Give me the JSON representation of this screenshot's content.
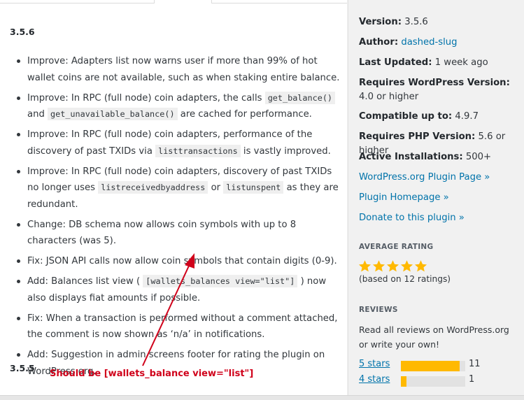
{
  "main": {
    "versions": [
      "3.5.6",
      "3.5.5"
    ],
    "changes": [
      {
        "parts": [
          {
            "t": "text",
            "v": "Improve: Adapters list now warns user if more than 99% of hot wallet coins are not available, such as when staking entire balance."
          }
        ]
      },
      {
        "parts": [
          {
            "t": "text",
            "v": "Improve: In RPC (full node) coin adapters, the calls "
          },
          {
            "t": "code",
            "v": "get_balance()"
          },
          {
            "t": "text",
            "v": " and "
          },
          {
            "t": "code",
            "v": "get_unavailable_balance()"
          },
          {
            "t": "text",
            "v": " are cached for performance."
          }
        ]
      },
      {
        "parts": [
          {
            "t": "text",
            "v": "Improve: In RPC (full node) coin adapters, performance of the discovery of past TXIDs via "
          },
          {
            "t": "code",
            "v": "listtransactions"
          },
          {
            "t": "text",
            "v": " is vastly improved."
          }
        ]
      },
      {
        "parts": [
          {
            "t": "text",
            "v": "Improve: In RPC (full node) coin adapters, discovery of past TXIDs no longer uses "
          },
          {
            "t": "code",
            "v": "listreceivedbyaddress"
          },
          {
            "t": "text",
            "v": " or "
          },
          {
            "t": "code",
            "v": "listunspent"
          },
          {
            "t": "text",
            "v": " as they are redundant."
          }
        ]
      },
      {
        "parts": [
          {
            "t": "text",
            "v": "Change: DB schema now allows coin symbols with up to 8 characters (was 5)."
          }
        ]
      },
      {
        "parts": [
          {
            "t": "text",
            "v": "Fix: JSON API calls now allow coin symbols that contain digits (0-9)."
          }
        ]
      },
      {
        "parts": [
          {
            "t": "text",
            "v": "Add: Balances list view ( "
          },
          {
            "t": "code",
            "v": "[wallets_balances view=\"list\"]"
          },
          {
            "t": "text",
            "v": " ) now also displays fiat amounts if possible."
          }
        ]
      },
      {
        "parts": [
          {
            "t": "text",
            "v": "Fix: When a transaction is performed without a comment attached, the comment is now shown as ‘n/a’ in notifications."
          }
        ]
      },
      {
        "parts": [
          {
            "t": "text",
            "v": "Add: Suggestion in admin screens footer for rating the plugin on WordPress.org."
          }
        ]
      }
    ],
    "annotation": "Should be [wallets_balance view=\"list\"]"
  },
  "sidebar": {
    "meta": [
      {
        "label": "Version:",
        "value": "3.5.6",
        "link": false
      },
      {
        "label": "Author:",
        "value": "dashed-slug",
        "link": true
      },
      {
        "label": "Last Updated:",
        "value": "1 week ago",
        "link": false
      },
      {
        "label": "Requires WordPress Version:",
        "value": "4.0 or higher",
        "link": false
      },
      {
        "label": "Compatible up to:",
        "value": "4.9.7",
        "link": false
      },
      {
        "label": "Requires PHP Version:",
        "value": "5.6 or higher",
        "link": false
      },
      {
        "label": "Active Installations:",
        "value": "500+",
        "link": false
      }
    ],
    "links": [
      "WordPress.org Plugin Page »",
      "Plugin Homepage »",
      "Donate to this plugin »"
    ],
    "average_rating_heading": "AVERAGE RATING",
    "rating_value": 5,
    "rating_note": "(based on 12 ratings)",
    "reviews_heading": "REVIEWS",
    "reviews_text": "Read all reviews on WordPress.org or write your own!",
    "rating_bars": [
      {
        "label": "5 stars",
        "count": "11",
        "fraction": 0.917
      },
      {
        "label": "4 stars",
        "count": "1",
        "fraction": 0.083
      }
    ],
    "colors": {
      "link": "#0073aa",
      "star": "#ffb900",
      "annotation": "#d0021b"
    }
  }
}
